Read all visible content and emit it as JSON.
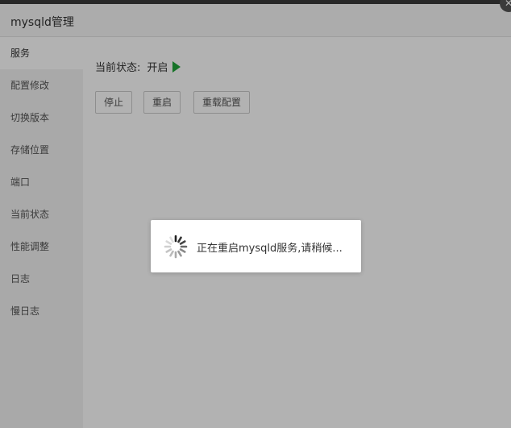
{
  "window": {
    "title": "mysqld管理",
    "close_glyph": "✕"
  },
  "sidebar": {
    "items": [
      {
        "label": "服务",
        "active": true
      },
      {
        "label": "配置修改"
      },
      {
        "label": "切换版本"
      },
      {
        "label": "存储位置"
      },
      {
        "label": "端口"
      },
      {
        "label": "当前状态"
      },
      {
        "label": "性能调整"
      },
      {
        "label": "日志"
      },
      {
        "label": "慢日志"
      }
    ]
  },
  "service": {
    "status_label": "当前状态:",
    "status_value": "开启",
    "status_icon": "play-icon",
    "status_color": "#20a53a",
    "buttons": {
      "stop": "停止",
      "restart": "重启",
      "reload": "重载配置"
    }
  },
  "loading": {
    "message": "正在重启mysqld服务,请稍候..."
  }
}
